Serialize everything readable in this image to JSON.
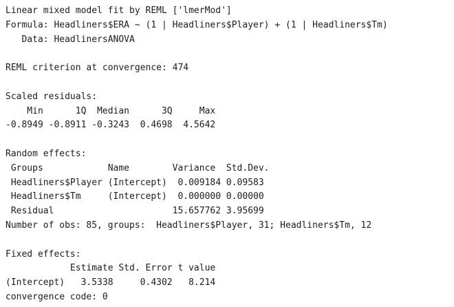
{
  "console": {
    "lines": [
      "Linear mixed model fit by REML ['lmerMod']",
      "Formula: Headliners$ERA ~ (1 | Headliners$Player) + (1 | Headliners$Tm)",
      "   Data: HeadlinersANOVA",
      "",
      "REML criterion at convergence: 474",
      "",
      "Scaled residuals:",
      "    Min      1Q  Median      3Q     Max",
      "-0.8949 -0.8911 -0.3243  0.4698  4.5642",
      "",
      "Random effects:",
      " Groups            Name        Variance  Std.Dev.",
      " Headliners$Player (Intercept)  0.009184 0.09583",
      " Headliners$Tm     (Intercept)  0.000000 0.00000",
      " Residual                      15.657762 3.95699",
      "Number of obs: 85, groups:  Headliners$Player, 31; Headliners$Tm, 12",
      "",
      "Fixed effects:",
      "            Estimate Std. Error t value",
      "(Intercept)   3.5338     0.4302   8.214",
      "convergence code: 0"
    ]
  }
}
